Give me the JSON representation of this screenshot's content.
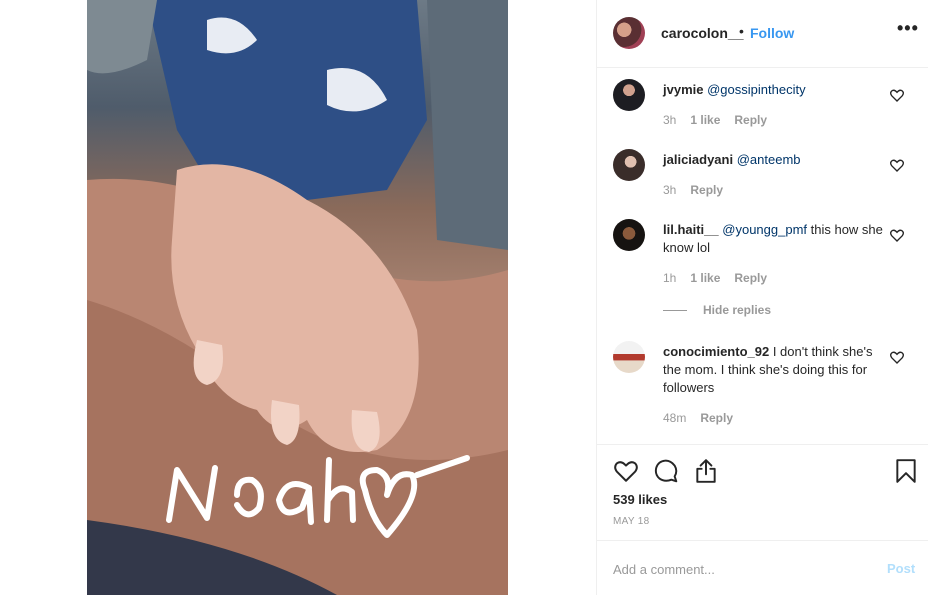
{
  "header": {
    "username": "carocolon__",
    "separator": "•",
    "follow_label": "Follow",
    "more_label": "•••"
  },
  "photo": {
    "caption_text": "Noah",
    "icon": "heart-doodle-icon"
  },
  "comments": [
    {
      "username": "jvymie",
      "mention": "@gossipinthecity",
      "text": "",
      "time": "3h",
      "likes": "1 like",
      "reply": "Reply"
    },
    {
      "username": "jaliciadyani",
      "mention": "@anteemb",
      "text": "",
      "time": "3h",
      "likes": "",
      "reply": "Reply"
    },
    {
      "username": "lil.haiti__",
      "mention": "@youngg_pmf",
      "text": " this how she know lol",
      "time": "1h",
      "likes": "1 like",
      "reply": "Reply"
    },
    {
      "username": "conocimiento_92",
      "mention": "",
      "text": " I don't think she's the mom. I think she's doing this for followers",
      "time": "48m",
      "likes": "",
      "reply": "Reply"
    }
  ],
  "hide_replies_label": "Hide replies",
  "actions": {
    "like_icon": "heart-icon",
    "comment_icon": "comment-bubble-icon",
    "share_icon": "share-icon",
    "save_icon": "bookmark-icon",
    "likes_label": "539 likes",
    "date": "MAY 18"
  },
  "add_comment": {
    "placeholder": "Add a comment...",
    "post_label": "Post"
  },
  "colors": {
    "link_blue": "#3897f0",
    "mention_blue": "#003569",
    "muted_gray": "#999999",
    "post_disabled": "#b2dffc"
  }
}
